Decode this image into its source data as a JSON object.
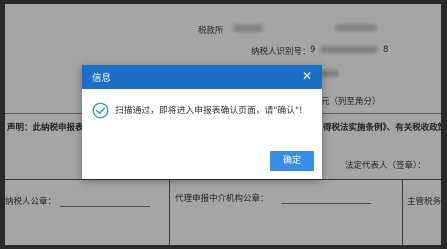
{
  "form": {
    "taxpayer_name_label": "税款所",
    "taxpayer_id_label": "纳税人识别号：",
    "taxpayer_id_prefix": "9",
    "taxpayer_id_suffix": "8",
    "unit_text": "元（列至角分）",
    "declaration_left": "声明：此纳税申报表",
    "declaration_right": "得税法实施条例》、有关税收政策",
    "legal_rep_label": "法定代表人（签章）：",
    "taxpayer_seal_label": "纳税人公章：",
    "agent_seal_label": "代理申报中介机构公章：",
    "tax_authority_label": "主管税务机"
  },
  "dialog": {
    "title": "信息",
    "close_symbol": "✕",
    "message": "扫描通过，即将进入申报表确认页面，请\"确认\"!",
    "ok_label": "确定"
  },
  "colors": {
    "header": "#1e6fc8",
    "ok_button": "#3b8ee8",
    "success_icon": "#27a9a0"
  }
}
